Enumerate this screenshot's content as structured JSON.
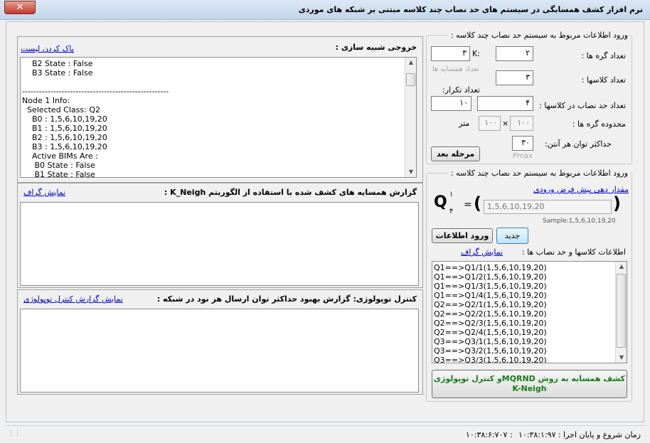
{
  "window": {
    "title": "نرم افزار کشف همسایگی در سیستم های حد نصاب چند کلاسه مبتنی بر شبکه های موردی",
    "close_glyph": "✕"
  },
  "output": {
    "title": "خروجی شبیه سازی :",
    "clear_link": "پاک کردن لیست",
    "lines": [
      "    B2 State : False",
      "    B3 State : False",
      "",
      "----------------------------------------------------",
      "Node 1 Info:",
      "  Selected Class: Q2",
      "    B0 : 1,5,6,10,19,20",
      "    B1 : 1,5,6,10,19,20",
      "    B2 : 1,5,6,10,19,20",
      "    B3 : 1,5,6,10,19,20",
      "    Active BIMs Are :",
      "     B0 State : False",
      "     B1 State : False"
    ]
  },
  "kneigh": {
    "title": "گزارش همسایه های کشف شده با استفاده از الگوریتم K_Neigh :",
    "link": "نمایش گراف"
  },
  "topology": {
    "title": "کنترل توپولوژی: گزارش بهبود حداکثر توان ارسال هر نود در شبکه :",
    "link": "نمایش گزارش کنترل توپولوژی"
  },
  "system_input": {
    "group_title": "ورود اطلاعات مربوط به سیستم حد نصاب چند کلاسه :",
    "nodes_label": "تعداد گره ها :",
    "nodes_value": "۲",
    "k_label": "K:",
    "k_value": "۳",
    "neighbors_count_label": "تعداد همسایه ها",
    "classes_label": "تعداد کلاسها :",
    "classes_value": "۳",
    "repeat_label": "تعداد تکرار:",
    "repeat_value": "۱۰",
    "quorum_label": "تعداد حد نصاب در کلاسها :",
    "quorum_value": "۴",
    "area_label": "محدوده گره ها :",
    "area_x": "۱۰۰",
    "area_times": "×",
    "area_y": "۱۰۰",
    "area_unit": "متر",
    "power_label": "حداکثر توان هر آنتن:",
    "power_value": "۳۰",
    "pmax_label": "Pmax",
    "next_button": "مرحله بعد"
  },
  "quorum_input": {
    "group_title": "ورود اطلاعات مربوط به سیستم حد نصاب چند کلاسه :",
    "default_link": "مقدار دهی پیش فرض ورودی",
    "q_letter": "Q",
    "q_super": "۱",
    "q_sub": "۴",
    "equals": "=",
    "paren_open": "(",
    "paren_close": ")",
    "quorum_text": "1,5,6,10,19,20",
    "sample_text": "Sample:1,5,6,10,19,20",
    "new_button": "جدید",
    "enter_button": "ورود اطلاعات",
    "list_label": "اطلاعات کلاسها و حد نصاب ها :",
    "graph_link": "نمایش گراف",
    "list_items": [
      "Q1==>Q1/1(1,5,6,10,19,20)",
      "Q1==>Q1/2(1,5,6,10,19,20)",
      "Q1==>Q1/3(1,5,6,10,19,20)",
      "Q1==>Q1/4(1,5,6,10,19,20)",
      "Q2==>Q2/1(1,5,6,10,19,20)",
      "Q2==>Q2/2(1,5,6,10,19,20)",
      "Q2==>Q2/3(1,5,6,10,19,20)",
      "Q2==>Q2/4(1,5,6,10,19,20)",
      "Q3==>Q3/1(1,5,6,10,19,20)",
      "Q3==>Q3/2(1,5,6,10,19,20)",
      "Q3==>Q3/3(1,5,6,10,19,20)"
    ],
    "run_button_line1": "کشف همسایه به روش MQRNDو کنترل توپولوژی",
    "run_button_line2": "K-Neigh"
  },
  "status": {
    "label": "زمان شروع و پایان اجرا :",
    "start_time": "۱۰:۳۸:۱:۹۷",
    "separator": ":",
    "end_time": "۱۰:۳۸:۶:۷۰۷"
  },
  "colors": {
    "run_button_text": "#1a7a1a",
    "link": "#0000cc"
  }
}
